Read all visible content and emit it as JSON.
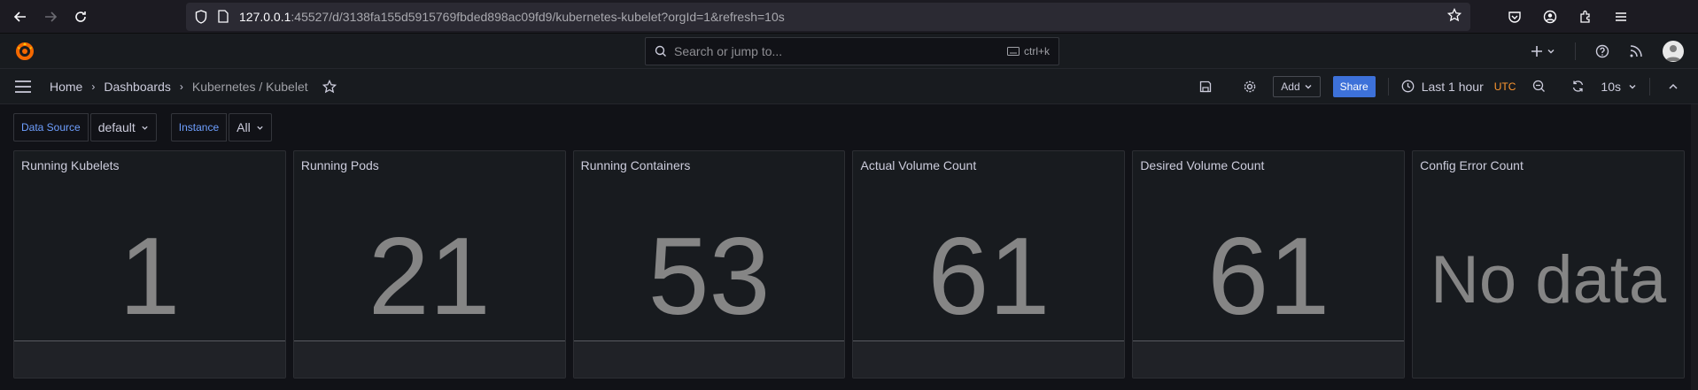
{
  "browser": {
    "url_host": "127.0.0.1",
    "url_rest": ":45527/d/3138fa155d5915769fbded898ac09fd9/kubernetes-kubelet?orgId=1&refresh=10s"
  },
  "topbar": {
    "search_placeholder": "Search or jump to...",
    "search_shortcut": "ctrl+k"
  },
  "breadcrumb": {
    "items": [
      "Home",
      "Dashboards",
      "Kubernetes / Kubelet"
    ]
  },
  "toolbar": {
    "add_label": "Add",
    "share_label": "Share",
    "time_range": "Last 1 hour",
    "timezone": "UTC",
    "refresh_interval": "10s"
  },
  "variables": [
    {
      "label": "Data Source",
      "value": "default"
    },
    {
      "label": "Instance",
      "value": "All"
    }
  ],
  "panels": [
    {
      "title": "Running Kubelets",
      "value": "1"
    },
    {
      "title": "Running Pods",
      "value": "21"
    },
    {
      "title": "Running Containers",
      "value": "53"
    },
    {
      "title": "Actual Volume Count",
      "value": "61"
    },
    {
      "title": "Desired Volume Count",
      "value": "61"
    },
    {
      "title": "Config Error Count",
      "value": "No data"
    }
  ],
  "colors": {
    "accent": "#3d71d9",
    "utc": "#ff9830",
    "variable_label": "#6e9fff",
    "stat_value": "#858585"
  }
}
